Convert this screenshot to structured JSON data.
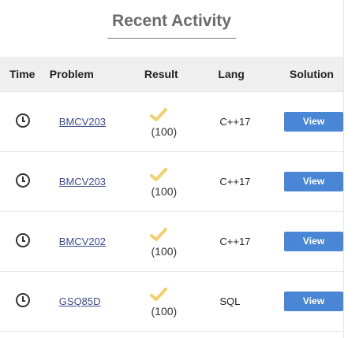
{
  "panel": {
    "title": "Recent Activity"
  },
  "table": {
    "headers": {
      "time": "Time",
      "problem": "Problem",
      "result": "Result",
      "lang": "Lang",
      "solution": "Solution"
    },
    "rows": [
      {
        "problem": "BMCV203",
        "result_icon": "check-icon",
        "score": "(100)",
        "lang": "C++17",
        "solution_label": "View"
      },
      {
        "problem": "BMCV203",
        "result_icon": "check-icon",
        "score": "(100)",
        "lang": "C++17",
        "solution_label": "View"
      },
      {
        "problem": "BMCV202",
        "result_icon": "check-icon",
        "score": "(100)",
        "lang": "C++17",
        "solution_label": "View"
      },
      {
        "problem": "GSQ85D",
        "result_icon": "check-icon",
        "score": "(100)",
        "lang": "SQL",
        "solution_label": "View"
      }
    ]
  },
  "colors": {
    "header_bg": "#efefef",
    "check": "#f2d06b",
    "button": "#4a86d6",
    "link": "#3b4a8c"
  }
}
